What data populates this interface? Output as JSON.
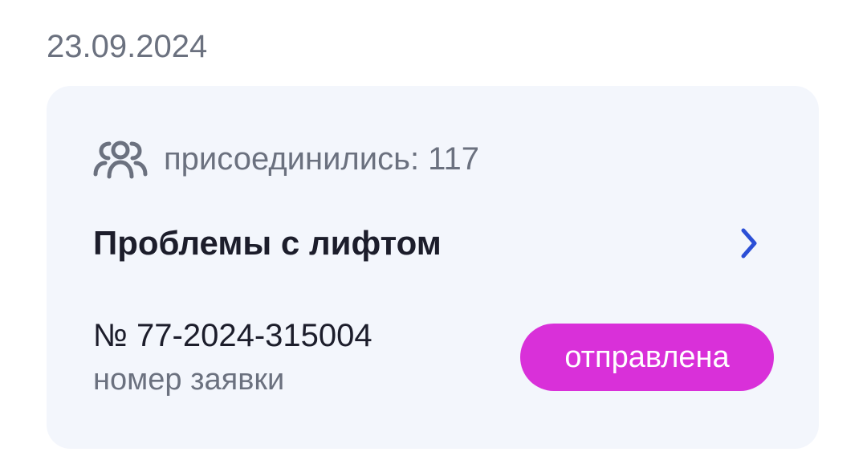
{
  "date": "23.09.2024",
  "card": {
    "joined_text": "присоединились: 117",
    "joined_icon": "people-group-icon",
    "title": "Проблемы с лифтом",
    "chevron_icon": "chevron-right-icon",
    "request_number": "№ 77-2024-315004",
    "request_number_label": "номер заявки",
    "status": "отправлена"
  },
  "colors": {
    "card_background": "#f3f6fc",
    "muted_text": "#6b717f",
    "title_text": "#1c1d2b",
    "chevron": "#2b4fd6",
    "status_badge": "#d930d9",
    "status_text": "#ffffff"
  }
}
